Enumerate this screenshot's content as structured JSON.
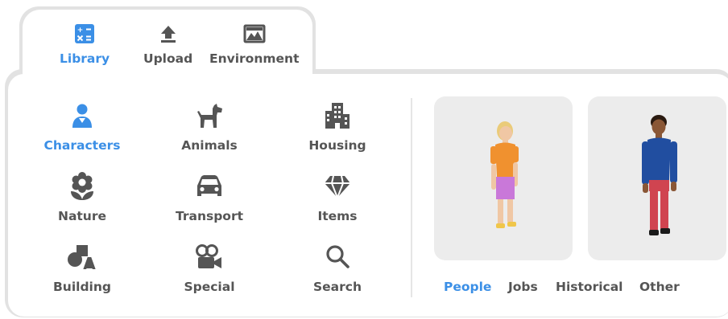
{
  "colors": {
    "accent": "#3b8fe6",
    "text": "#555555",
    "card": "#ececec"
  },
  "tabs": [
    {
      "label": "Library",
      "icon": "library-icon",
      "active": true
    },
    {
      "label": "Upload",
      "icon": "upload-icon",
      "active": false
    },
    {
      "label": "Environment",
      "icon": "environment-icon",
      "active": false
    }
  ],
  "categories": [
    {
      "label": "Characters",
      "icon": "person-icon",
      "active": true
    },
    {
      "label": "Animals",
      "icon": "dog-icon",
      "active": false
    },
    {
      "label": "Housing",
      "icon": "city-icon",
      "active": false
    },
    {
      "label": "Nature",
      "icon": "flower-icon",
      "active": false
    },
    {
      "label": "Transport",
      "icon": "car-icon",
      "active": false
    },
    {
      "label": "Items",
      "icon": "diamond-icon",
      "active": false
    },
    {
      "label": "Building",
      "icon": "shapes-icon",
      "active": false
    },
    {
      "label": "Special",
      "icon": "video-camera-icon",
      "active": false
    },
    {
      "label": "Search",
      "icon": "search-icon",
      "active": false
    }
  ],
  "cards": [
    {
      "name": "character-blonde-child",
      "hair": "#eacb79",
      "skin": "#f0c7a4",
      "shirt": "#f0912f",
      "pants": "#c978d9",
      "shoes": "#f0c64a"
    },
    {
      "name": "character-dark-adult",
      "hair": "#2a1a10",
      "skin": "#8a5736",
      "shirt": "#214ea0",
      "pants": "#d04450",
      "shoes": "#1a1a1a"
    }
  ],
  "subtabs": [
    {
      "label": "People",
      "active": true
    },
    {
      "label": "Jobs",
      "active": false
    },
    {
      "label": "Historical",
      "active": false
    },
    {
      "label": "Other",
      "active": false
    }
  ]
}
